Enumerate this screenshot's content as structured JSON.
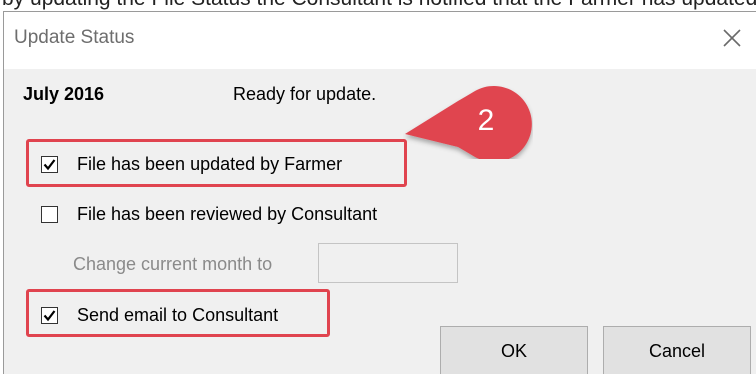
{
  "background_text": "by updating the File Status the Consultant is notified that the Farmer has updated the file",
  "dialog": {
    "title": "Update Status",
    "month": "July 2016",
    "status": "Ready for update.",
    "checkboxes": [
      {
        "label": "File has been updated by Farmer",
        "checked": true
      },
      {
        "label": "File has been reviewed by Consultant",
        "checked": false
      },
      {
        "label": "Send email to Consultant",
        "checked": true
      }
    ],
    "change_month_label": "Change current month to",
    "change_month_value": "",
    "ok_label": "OK",
    "cancel_label": "Cancel"
  },
  "annotation": {
    "step_number": "2",
    "color": "#e0444f"
  },
  "icons": {
    "close": "close-icon",
    "check": "checkmark-icon"
  }
}
